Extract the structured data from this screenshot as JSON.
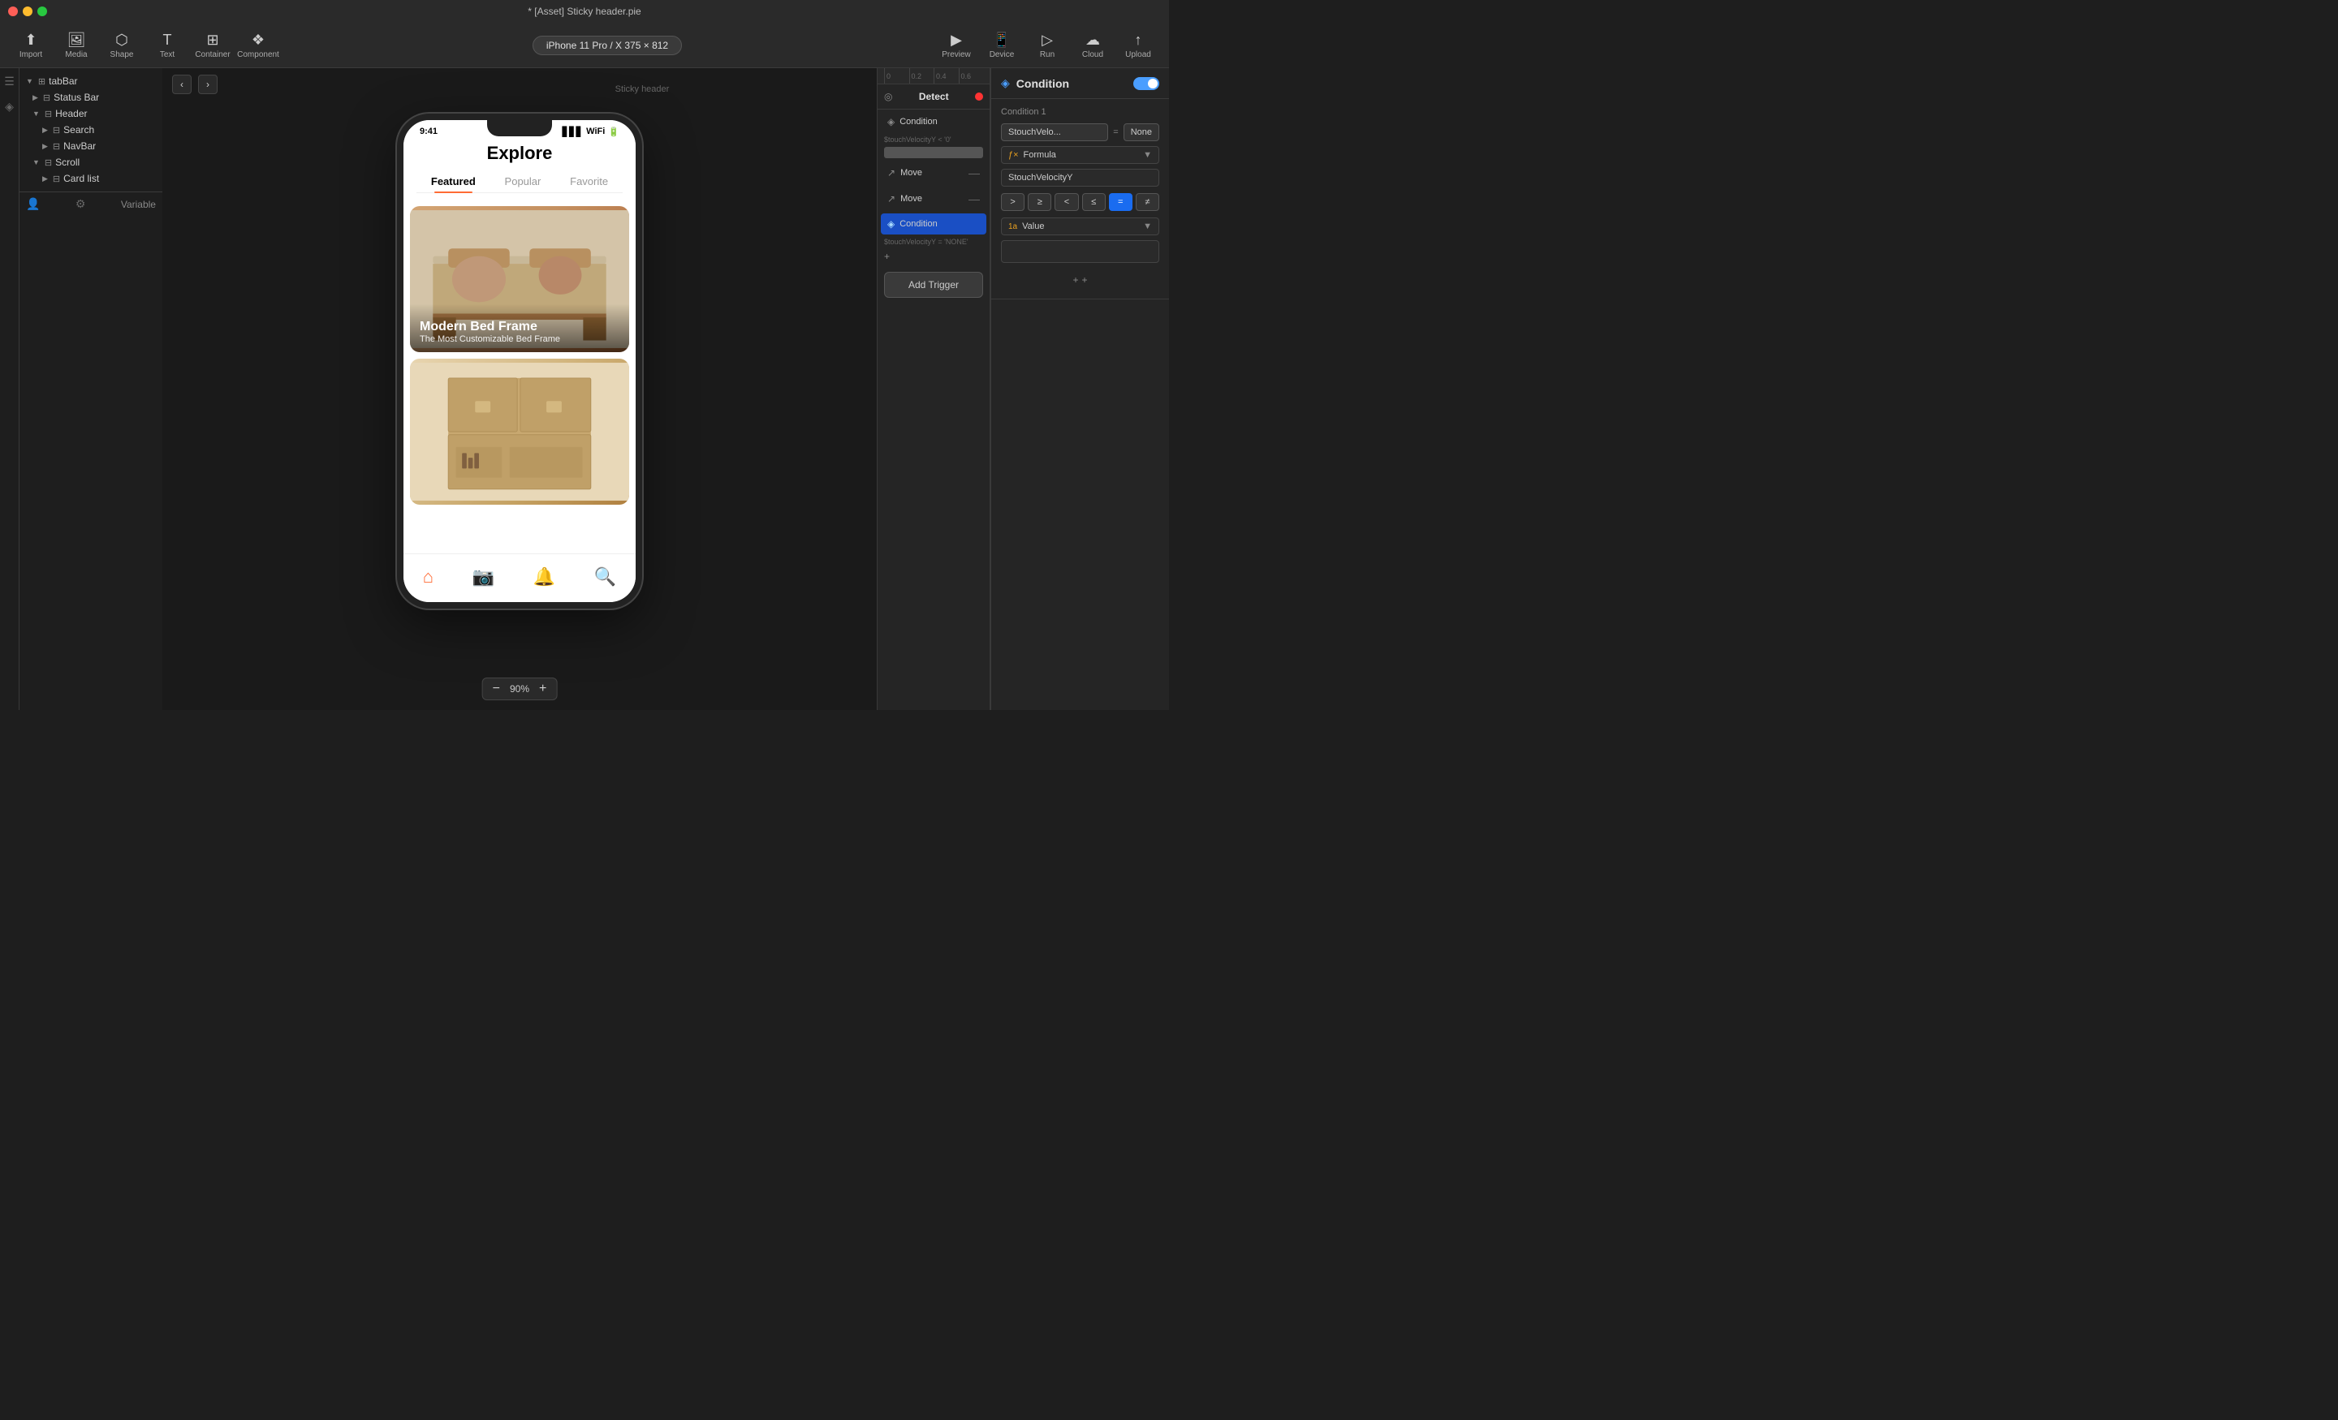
{
  "titlebar": {
    "title": "* [Asset] Sticky header.pie"
  },
  "toolbar": {
    "import_label": "Import",
    "media_label": "Media",
    "shape_label": "Shape",
    "text_label": "Text",
    "container_label": "Container",
    "component_label": "Component",
    "device_label": "iPhone 11 Pro / X  375 × 812",
    "preview_label": "Preview",
    "device_nav_label": "Device",
    "run_label": "Run",
    "cloud_label": "Cloud",
    "upload_label": "Upload"
  },
  "sidebar": {
    "items": [
      {
        "label": "tabBar",
        "level": 0,
        "expanded": true
      },
      {
        "label": "Status Bar",
        "level": 1,
        "expanded": false
      },
      {
        "label": "Header",
        "level": 1,
        "expanded": true
      },
      {
        "label": "Search",
        "level": 2,
        "expanded": false
      },
      {
        "label": "NavBar",
        "level": 2,
        "expanded": false
      },
      {
        "label": "Scroll",
        "level": 1,
        "expanded": true
      },
      {
        "label": "Card list",
        "level": 2,
        "expanded": false
      }
    ],
    "variable_label": "Variable"
  },
  "canvas": {
    "label": "Sticky header",
    "zoom": "90%",
    "phone": {
      "time": "9:41",
      "title": "Explore",
      "tabs": [
        "Featured",
        "Popular",
        "Favorite"
      ],
      "active_tab": "Featured",
      "card1": {
        "title": "Modern Bed Frame",
        "subtitle": "The Most Customizable Bed Frame"
      },
      "card2": {
        "title": "",
        "subtitle": ""
      }
    }
  },
  "triggers_panel": {
    "detect_label": "Detect",
    "condition1_label": "Condition",
    "condition1_sub": "$touchVelocityY < '0'",
    "move1_label": "Move",
    "move2_label": "Move",
    "condition2_label": "Condition",
    "condition2_sub": "$touchVelocityY = 'NONE'",
    "plus_label": "+",
    "add_trigger_label": "Add Trigger",
    "timeline_marks": [
      "0",
      "0.2",
      "0.4",
      "0.6"
    ]
  },
  "condition_panel": {
    "title": "Condition",
    "toggle_on": true,
    "condition1_label": "Condition 1",
    "variable": "StouchVelo...",
    "operator_display": "=",
    "value_display": "None",
    "formula_label": "Formula",
    "formula_input": "StouchVelocityY",
    "operators": [
      ">",
      "≥",
      "<",
      "≤",
      "=",
      "≠"
    ],
    "active_operator": "=",
    "value_type_label": "Value",
    "value_prefix": "1a",
    "value_input": "",
    "add_label": "+"
  }
}
